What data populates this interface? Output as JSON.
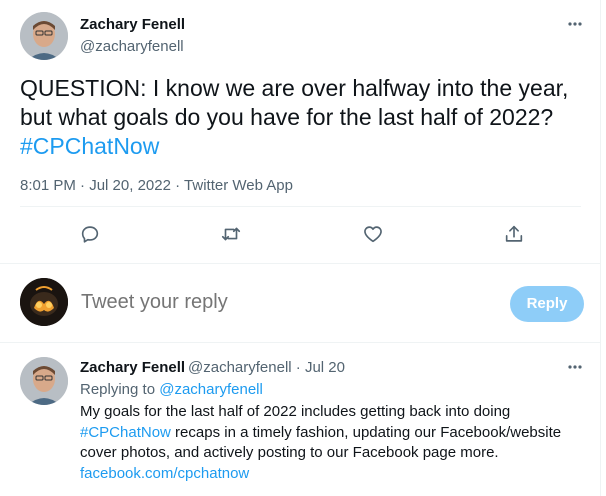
{
  "main_tweet": {
    "display_name": "Zachary Fenell",
    "handle": "@zacharyfenell",
    "text_line1": "QUESTION: I know we are over halfway into the year,",
    "text_line2": "but what goals do you have for the last half of 2022?",
    "hashtag": "#CPChatNow",
    "time": "8:01 PM",
    "separator": "·",
    "date": "Jul 20, 2022",
    "source": "Twitter Web App"
  },
  "actions": {
    "reply_icon": "reply-icon",
    "retweet_icon": "retweet-icon",
    "like_icon": "heart-icon",
    "share_icon": "share-icon"
  },
  "compose": {
    "placeholder": "Tweet your reply",
    "reply_label": "Reply"
  },
  "reply_tweet": {
    "display_name": "Zachary Fenell",
    "meta": "@zacharyfenell · Jul 20",
    "replying_prefix": "Replying to ",
    "replying_to": "@zacharyfenell",
    "line1": "My goals for the last half of 2022 includes getting back into doing",
    "hashtag": "#CPChatNow",
    "line2_rest": " recaps in a timely fashion, updating our Facebook/website",
    "line3": "cover photos, and actively posting to our Facebook page more.",
    "link": "facebook.com/cpchatnow"
  },
  "colors": {
    "accent": "#1d9bf0",
    "secondary_text": "#536471",
    "reply_button_disabled": "#8ecdf8"
  }
}
